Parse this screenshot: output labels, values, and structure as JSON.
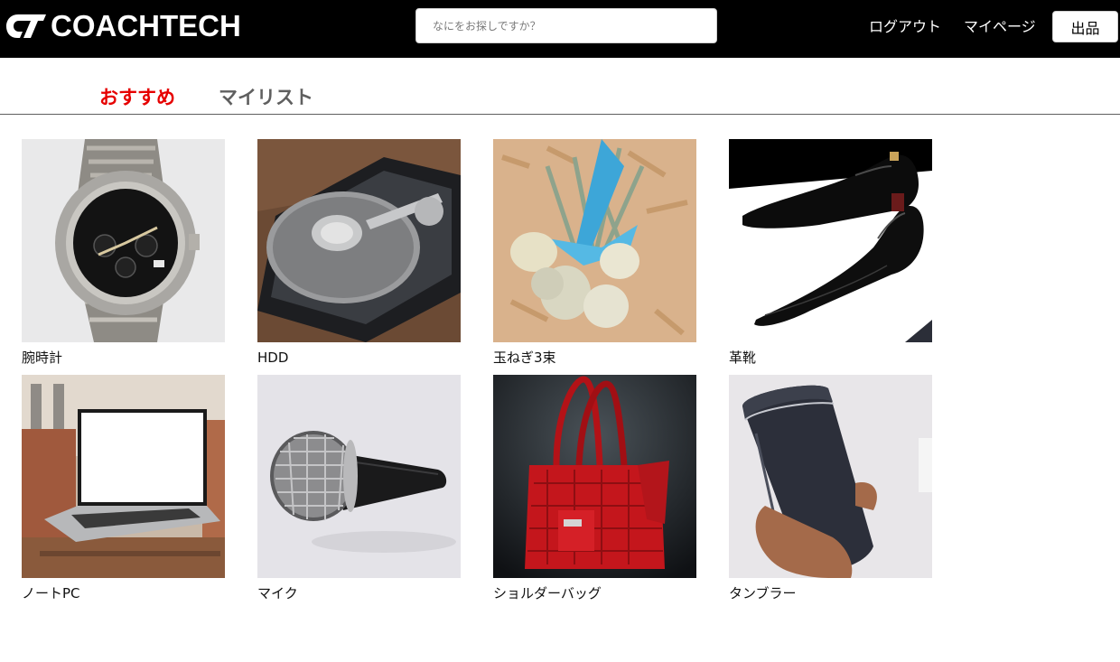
{
  "header": {
    "logo_text": "COACHTECH",
    "search_placeholder": "なにをお探しですか？",
    "logout_label": "ログアウト",
    "mypage_label": "マイページ",
    "sell_label": "出品"
  },
  "tabs": [
    {
      "label": "おすすめ",
      "active": true
    },
    {
      "label": "マイリスト",
      "active": false
    }
  ],
  "items": [
    {
      "name": "腕時計",
      "icon": "wristwatch-image"
    },
    {
      "name": "HDD",
      "icon": "hard-disk-image"
    },
    {
      "name": "玉ねぎ3束",
      "icon": "onion-bundle-image"
    },
    {
      "name": "革靴",
      "icon": "leather-shoes-image"
    },
    {
      "name": "ノートPC",
      "icon": "laptop-image"
    },
    {
      "name": "マイク",
      "icon": "microphone-image"
    },
    {
      "name": "ショルダーバッグ",
      "icon": "shoulder-bag-image"
    },
    {
      "name": "タンブラー",
      "icon": "tumbler-image"
    }
  ],
  "colors": {
    "header_bg": "#000000",
    "active_tab": "#e60000",
    "inactive_tab": "#5f5f5f"
  }
}
